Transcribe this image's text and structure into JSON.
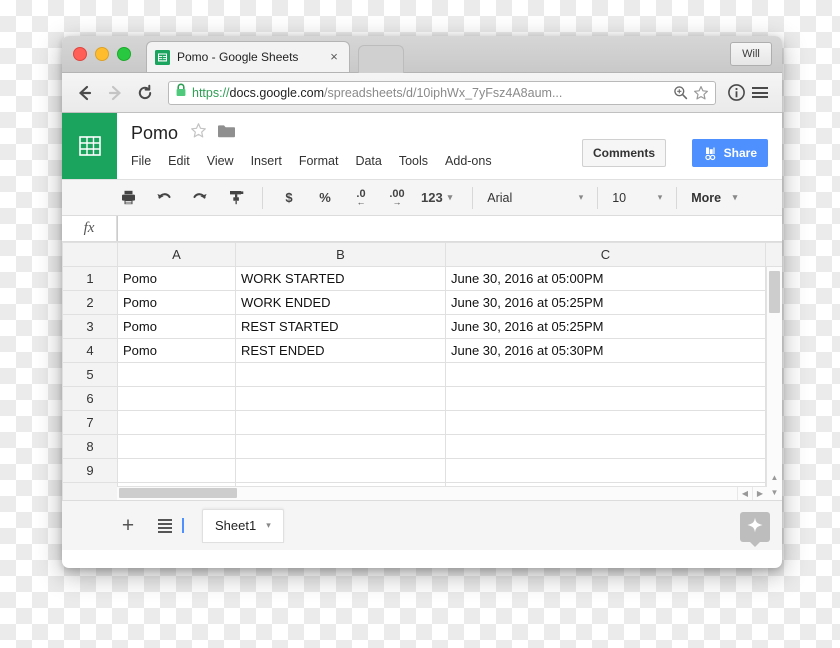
{
  "browser": {
    "tab": {
      "title": "Pomo - Google Sheets",
      "favicon": "sheets-favicon",
      "close_label": "×"
    },
    "new_tab_label": "",
    "profile_label": "Will",
    "nav": {
      "back_label": "←",
      "forward_label": "→",
      "reload_label": "⟳"
    },
    "omnibox": {
      "scheme": "https://",
      "host": "docs.google.com",
      "path": "/spreadsheets/d/10iphWx_7yFsz4A8aum...",
      "lock_icon": "lock-icon",
      "zoom_icon": "zoom-search-icon",
      "bookmark_icon": "star-outline-icon"
    },
    "info_icon": "info-icon",
    "menu_icon": "hamburger-menu-icon"
  },
  "sheets": {
    "logo_icon": "google-sheets-logo",
    "doc_title": "Pomo",
    "star_icon": "star-outline-icon",
    "folder_icon": "folder-icon",
    "menus": [
      "File",
      "Edit",
      "View",
      "Insert",
      "Format",
      "Data",
      "Tools",
      "Add-ons"
    ],
    "comments_label": "Comments",
    "share_label": "Share",
    "share_icon": "share-lock-icon",
    "toolbar": {
      "print_icon": "print-icon",
      "undo_icon": "undo-icon",
      "redo_icon": "redo-icon",
      "paint_icon": "paint-format-icon",
      "currency_label": "$",
      "percent_label": "%",
      "decrease_decimal_label": ".0",
      "increase_decimal_label": ".00",
      "number_format_label": "123",
      "font_name": "Arial",
      "font_size": "10",
      "more_label": "More",
      "caret": "▾"
    },
    "formula_bar": {
      "fx_label": "fx",
      "value": "",
      "placeholder": ""
    },
    "grid": {
      "columns": [
        "A",
        "B",
        "C"
      ],
      "row_numbers": [
        "1",
        "2",
        "3",
        "4",
        "5",
        "6",
        "7",
        "8",
        "9"
      ],
      "rows": [
        [
          "Pomo",
          "WORK STARTED",
          "June 30, 2016 at 05:00PM"
        ],
        [
          "Pomo",
          "WORK ENDED",
          "June 30, 2016 at 05:25PM"
        ],
        [
          "Pomo",
          "REST STARTED",
          "June 30, 2016 at 05:25PM"
        ],
        [
          "Pomo",
          "REST ENDED",
          "June 30, 2016 at 05:30PM"
        ],
        [
          "",
          "",
          ""
        ],
        [
          "",
          "",
          ""
        ],
        [
          "",
          "",
          ""
        ],
        [
          "",
          "",
          ""
        ],
        [
          "",
          "",
          ""
        ]
      ],
      "scroll_up_label": "▲",
      "scroll_down_label": "▼",
      "scroll_left_label": "◀",
      "scroll_right_label": "▶"
    },
    "bottom": {
      "add_sheet_label": "+",
      "sheet_list_icon": "all-sheets-icon",
      "sheet_tab_name": "Sheet1",
      "sheet_tab_caret": "▾",
      "explore_icon": "explore-star-icon"
    }
  },
  "colors": {
    "sheets_green": "#1ba45e",
    "share_blue": "#4d90fe",
    "url_green": "#2e9e54"
  }
}
